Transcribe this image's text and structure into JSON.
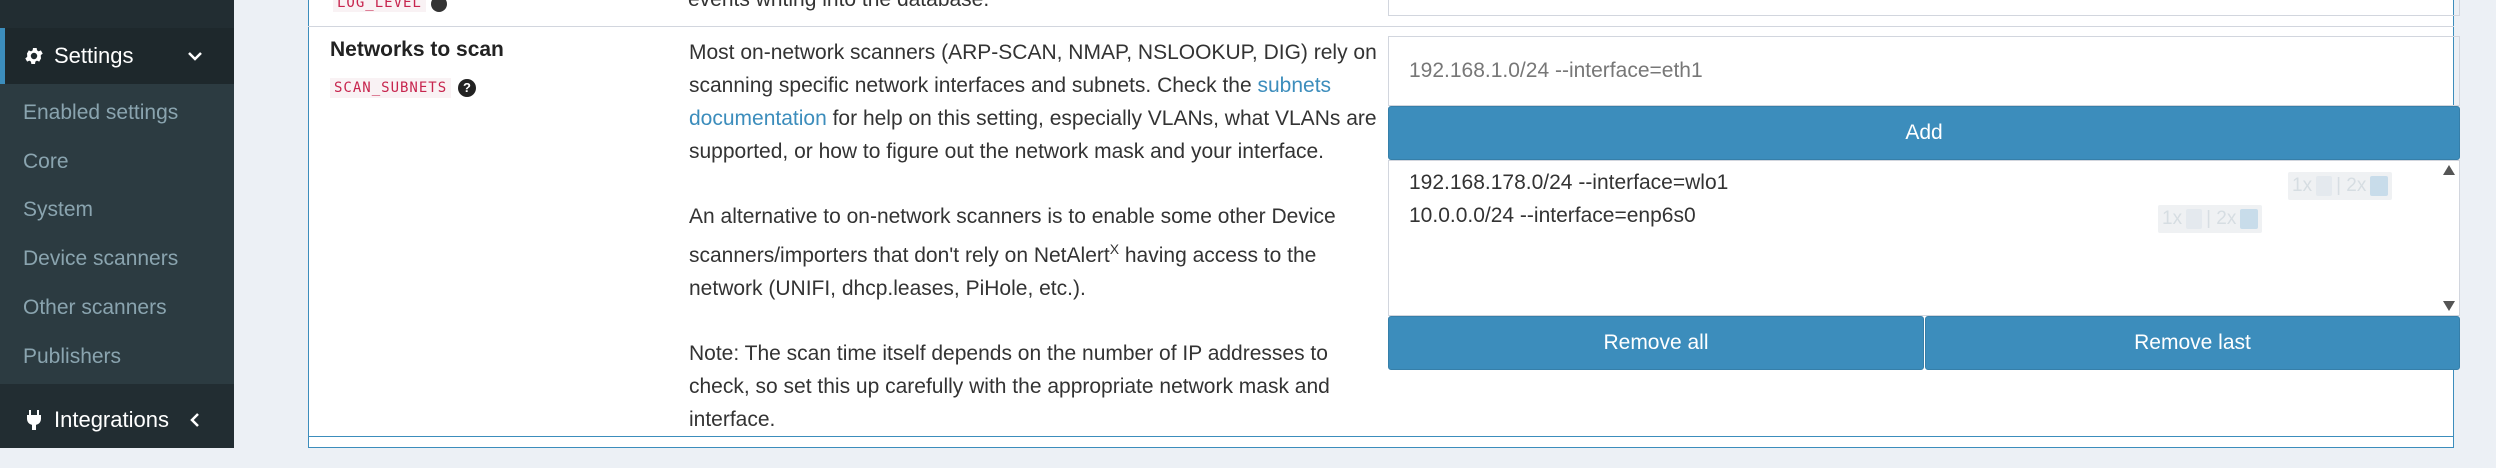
{
  "sidebar": {
    "settings_label": "Settings",
    "sub_items": [
      {
        "label": "Enabled settings"
      },
      {
        "label": "Core"
      },
      {
        "label": "System"
      },
      {
        "label": "Device scanners"
      },
      {
        "label": "Other scanners"
      },
      {
        "label": "Publishers"
      }
    ],
    "integrations_label": "Integrations"
  },
  "previous_setting": {
    "code": "LOG_LEVEL",
    "desc_fragment": "events writing into the database."
  },
  "setting": {
    "name": "Networks to scan",
    "code": "SCAN_SUBNETS",
    "desc_p1_a": "Most on-network scanners (ARP-SCAN, NMAP, NSLOOKUP, DIG) rely on scanning specific network interfaces and subnets. Check the ",
    "desc_p1_link": "subnets documentation",
    "desc_p1_b": " for help on this setting, especially VLANs, what VLANs are supported, or how to figure out the network mask and your interface.",
    "desc_p2_a": "An alternative to on-network scanners is to enable some other Device scanners/importers that don't rely on NetAlert",
    "desc_p2_sup": "X",
    "desc_p2_b": " having access to the network (UNIFI, dhcp.leases, PiHole, etc.).",
    "desc_p3": "Note: The scan time itself depends on the number of IP addresses to check, so set this up carefully with the appropriate network mask and interface.",
    "input_placeholder": "192.168.1.0/24 --interface=eth1",
    "add_label": "Add",
    "values": [
      "192.168.178.0/24 --interface=wlo1",
      "10.0.0.0/24 --interface=enp6s0"
    ],
    "remove_all_label": "Remove all",
    "remove_last_label": "Remove last"
  },
  "ghost_overlay": {
    "label_1x": "1x",
    "label_2x": "| 2x"
  },
  "colors": {
    "accent": "#3c8dbc",
    "sidebar_bg": "#222d32",
    "code_text": "#c7254e"
  }
}
